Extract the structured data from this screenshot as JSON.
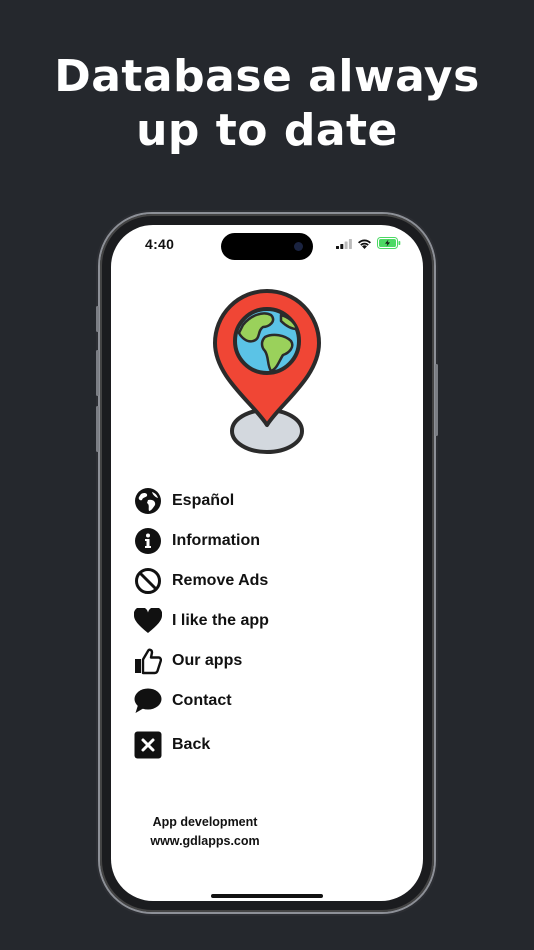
{
  "headline": {
    "line1": "Database always",
    "line2": "up to date"
  },
  "status": {
    "time": "4:40"
  },
  "menu": {
    "items": [
      {
        "label": "Español",
        "icon": "globe-icon"
      },
      {
        "label": "Information",
        "icon": "info-icon"
      },
      {
        "label": "Remove Ads",
        "icon": "no-symbol-icon"
      },
      {
        "label": "I like the app",
        "icon": "heart-icon"
      },
      {
        "label": "Our apps",
        "icon": "thumbs-up-icon"
      },
      {
        "label": "Contact",
        "icon": "speech-bubble-icon"
      },
      {
        "label": "Back",
        "icon": "close-box-icon"
      }
    ]
  },
  "footer": {
    "line1": "App development",
    "line2": "www.gdlapps.com"
  },
  "colors": {
    "background": "#25282d",
    "pin": "#f04635",
    "ocean": "#5bc3e6",
    "land": "#9ad15b"
  }
}
